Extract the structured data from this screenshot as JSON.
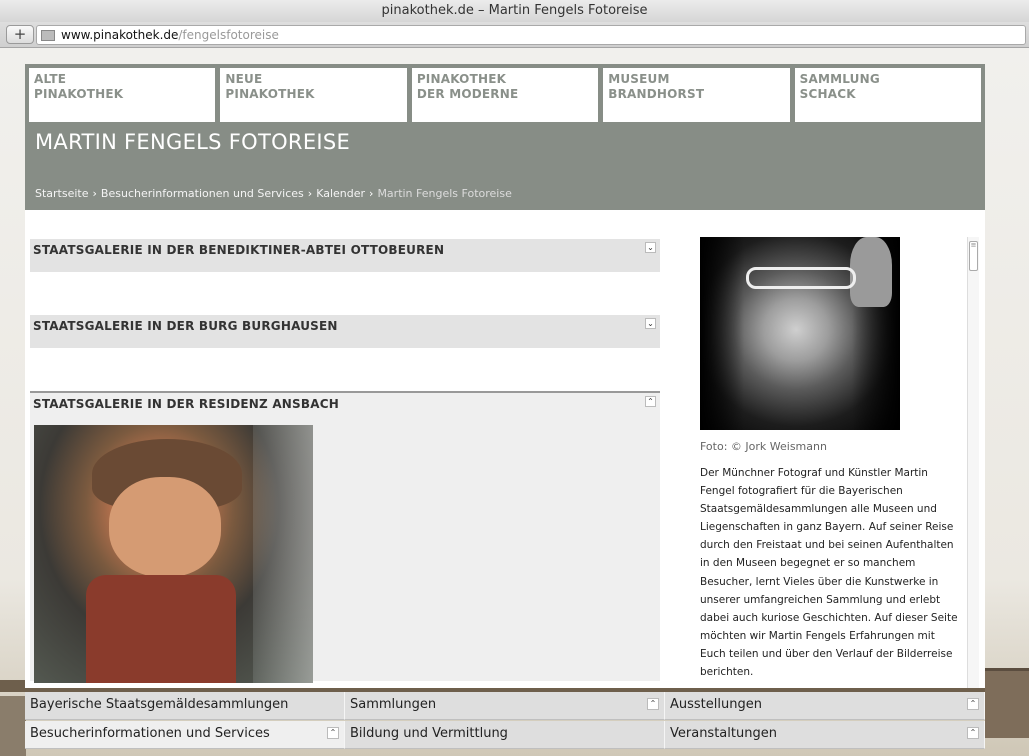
{
  "browser": {
    "window_title": "pinakothek.de – Martin Fengels Fotoreise",
    "url_host": "www.pinakothek.de",
    "url_path": "/fengelsfotoreise",
    "plus_label": "+"
  },
  "topnav": {
    "items": [
      {
        "line1": "ALTE",
        "line2": "PINAKOTHEK"
      },
      {
        "line1": "NEUE",
        "line2": "PINAKOTHEK"
      },
      {
        "line1": "PINAKOTHEK",
        "line2": "DER MODERNE"
      },
      {
        "line1": "MUSEUM",
        "line2": "BRANDHORST"
      },
      {
        "line1": "SAMMLUNG",
        "line2": "SCHACK"
      }
    ]
  },
  "header": {
    "title": "MARTIN FENGELS FOTOREISE",
    "breadcrumb": [
      "Startseite",
      "Besucherinformationen und Services",
      "Kalender",
      "Martin Fengels Fotoreise"
    ],
    "sep": "›"
  },
  "accordions": [
    {
      "title": "STAATSGALERIE IN DER BENEDIKTINER-ABTEI OTTOBEUREN",
      "toggle": "⌄"
    },
    {
      "title": "STAATSGALERIE IN DER BURG BURGHAUSEN",
      "toggle": "⌄"
    },
    {
      "title": "STAATSGALERIE IN DER RESIDENZ ANSBACH",
      "toggle": "⌃"
    }
  ],
  "sidebar": {
    "caption": "Foto: © Jork Weismann",
    "bio": "Der Münchner Fotograf und Künstler Martin Fengel fotografiert für die Bayerischen Staatsgemäldesammlungen alle Museen und Liegenschaften in ganz Bayern. Auf seiner Reise durch den Freistaat und bei seinen Aufenthalten in den Museen begegnet er so manchem Besucher, lernt Vieles über die Kunstwerke in unserer umfangreichen Sammlung und erlebt dabei auch kuriose Geschichten. Auf dieser Seite möchten wir Martin Fengels Erfahrungen mit Euch teilen und über den Verlauf der Bilderreise berichten."
  },
  "footer": {
    "items": [
      {
        "label": "Bayerische Staatsgemäldesammlungen",
        "caret": ""
      },
      {
        "label": "Sammlungen",
        "caret": "⌃"
      },
      {
        "label": "Ausstellungen",
        "caret": "⌃"
      },
      {
        "label": "Besucherinformationen und Services",
        "caret": "⌃"
      },
      {
        "label": "Bildung und Vermittlung",
        "caret": ""
      },
      {
        "label": "Veranstaltungen",
        "caret": "⌃"
      }
    ]
  },
  "colors": {
    "header_gray": "#878d86",
    "nav_text": "#8a908a",
    "accordion_bg": "#e3e3e3"
  }
}
